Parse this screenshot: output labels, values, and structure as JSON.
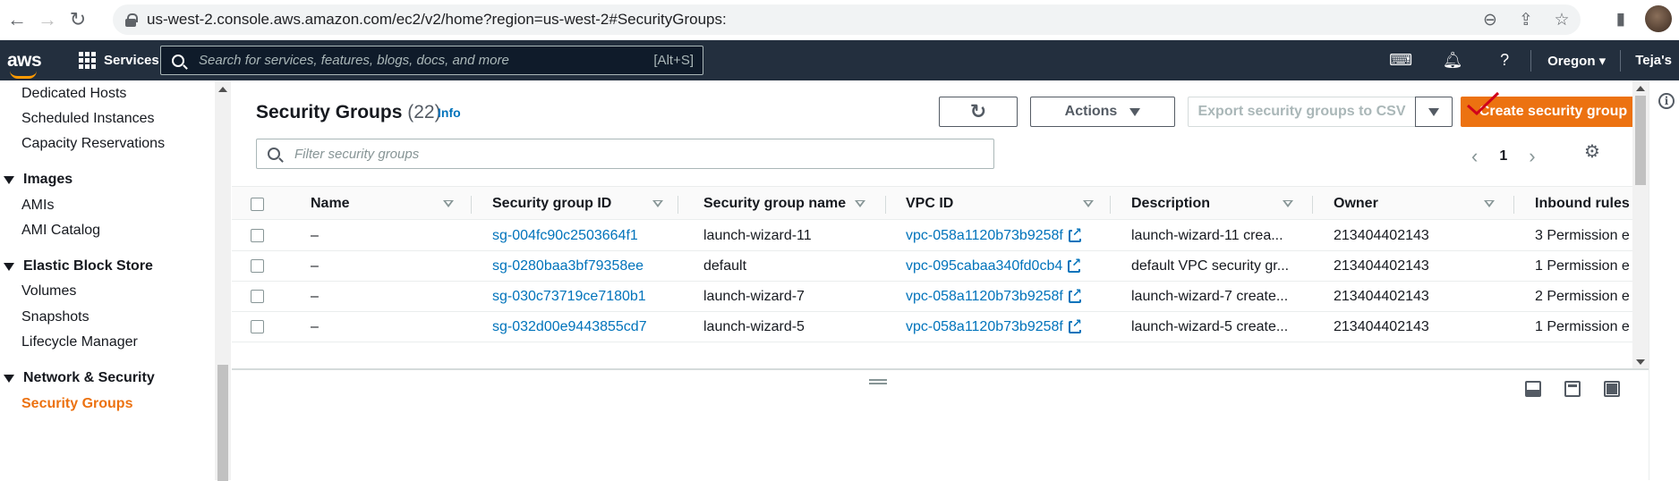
{
  "browser": {
    "url": "us-west-2.console.aws.amazon.com/ec2/v2/home?region=us-west-2#SecurityGroups:"
  },
  "aws_header": {
    "logo": "aws",
    "services_label": "Services",
    "search_placeholder": "Search for services, features, blogs, docs, and more",
    "search_shortcut": "[Alt+S]",
    "region": "Oregon",
    "user": "Teja's"
  },
  "sidebar": {
    "items": [
      {
        "label": "Dedicated Hosts"
      },
      {
        "label": "Scheduled Instances"
      },
      {
        "label": "Capacity Reservations"
      }
    ],
    "groups": [
      {
        "label": "Images",
        "items": [
          "AMIs",
          "AMI Catalog"
        ]
      },
      {
        "label": "Elastic Block Store",
        "items": [
          "Volumes",
          "Snapshots",
          "Lifecycle Manager"
        ]
      },
      {
        "label": "Network & Security",
        "items": [
          "Security Groups"
        ]
      }
    ]
  },
  "main": {
    "title": "Security Groups",
    "count": "(22)",
    "info": "Info",
    "actions_label": "Actions",
    "export_label": "Export security groups to CSV",
    "create_label": "Create security group",
    "filter_placeholder": "Filter security groups",
    "page": "1"
  },
  "table": {
    "columns": [
      "Name",
      "Security group ID",
      "Security group name",
      "VPC ID",
      "Description",
      "Owner",
      "Inbound rules"
    ],
    "rows": [
      {
        "name": "–",
        "sg_id": "sg-004fc90c2503664f1",
        "sg_name": "launch-wizard-11",
        "vpc": "vpc-058a1120b73b9258f",
        "desc": "launch-wizard-11 crea...",
        "owner": "213404402143",
        "inbound": "3 Permission e"
      },
      {
        "name": "–",
        "sg_id": "sg-0280baa3bf79358ee",
        "sg_name": "default",
        "vpc": "vpc-095cabaa340fd0cb4",
        "desc": "default VPC security gr...",
        "owner": "213404402143",
        "inbound": "1 Permission e"
      },
      {
        "name": "–",
        "sg_id": "sg-030c73719ce7180b1",
        "sg_name": "launch-wizard-7",
        "vpc": "vpc-058a1120b73b9258f",
        "desc": "launch-wizard-7 create...",
        "owner": "213404402143",
        "inbound": "2 Permission e"
      },
      {
        "name": "–",
        "sg_id": "sg-032d00e9443855cd7",
        "sg_name": "launch-wizard-5",
        "vpc": "vpc-058a1120b73b9258f",
        "desc": "launch-wizard-5 create...",
        "owner": "213404402143",
        "inbound": "1 Permission e"
      }
    ]
  },
  "colors": {
    "aws_nav": "#232f3e",
    "primary": "#ec7211",
    "link": "#0073bb"
  }
}
